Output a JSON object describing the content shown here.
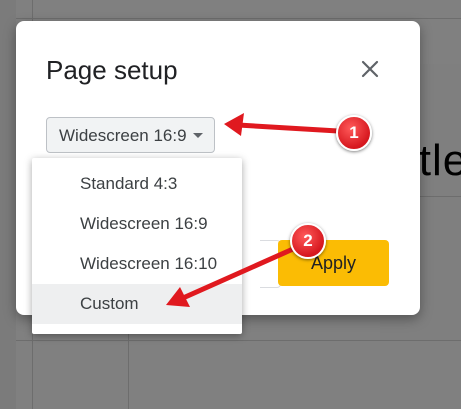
{
  "dialog": {
    "title": "Page setup",
    "close_icon": "close-icon",
    "size_select_value": "Widescreen 16:9",
    "apply_label": "Apply"
  },
  "dropdown": {
    "options": [
      {
        "label": "Standard 4:3"
      },
      {
        "label": "Widescreen 16:9"
      },
      {
        "label": "Widescreen 16:10"
      },
      {
        "label": "Custom",
        "highlighted": true
      }
    ]
  },
  "background": {
    "title_fragment": "itle"
  },
  "annotations": {
    "callout_1": "1",
    "callout_2": "2",
    "accent_color": "#e0191f"
  }
}
